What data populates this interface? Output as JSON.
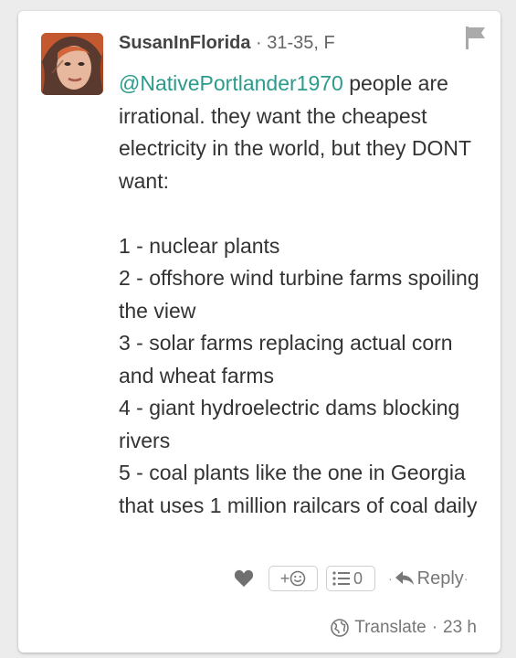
{
  "comment": {
    "username": "SusanInFlorida",
    "meta_separator": "·",
    "demographic": "31-35, F",
    "mention": "@NativePortlander1970",
    "body_lines": [
      "people are irrational. they want the cheapest electricity in the world, but they DONT want:",
      "1 - nuclear plants",
      "2 - offshore wind turbine farms spoiling the view",
      "3 - solar farms replacing actual corn and wheat farms",
      "4 - giant hydroelectric dams blocking rivers",
      "5 - coal plants like the one in Georgia that uses 1 million railcars of coal daily"
    ]
  },
  "actions": {
    "react_label": "+",
    "replies_count": "0",
    "reply_label": "Reply",
    "dot": "·"
  },
  "footer": {
    "translate_label": "Translate",
    "separator": "·",
    "timestamp": "23 h"
  },
  "icons": {
    "flag": "flag-icon",
    "heart": "heart-icon",
    "smiley": "smiley-icon",
    "list": "list-icon",
    "reply": "reply-arrow-icon",
    "globe": "globe-icon"
  },
  "colors": {
    "mention": "#2b9b8c",
    "icon_gray": "#777777",
    "card_bg": "#ffffff",
    "page_bg": "#ececec"
  }
}
